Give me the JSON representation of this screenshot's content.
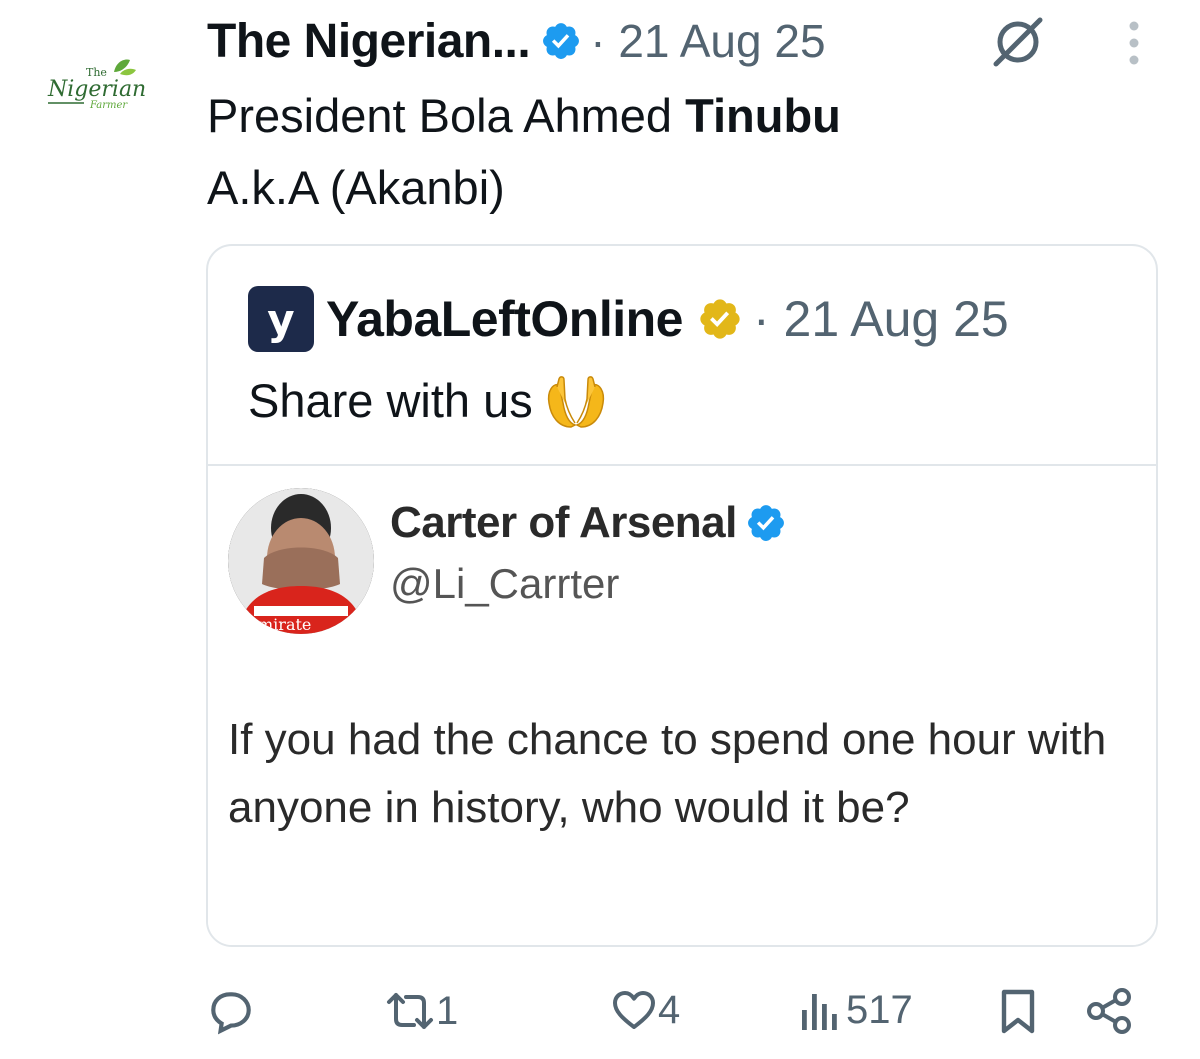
{
  "post": {
    "author_name": "The Nigerian...",
    "date": "· 21 Aug 25",
    "logo_text": {
      "top": "The",
      "middle": "Nigerian",
      "bottom": "Farmer"
    },
    "text_line1_prefix": "President Bola Ahmed ",
    "text_line1_bold": "Tinubu",
    "text_line2": "A.k.A (Akanbi)"
  },
  "quote": {
    "logo_letter": "y",
    "author_name": "YabaLeftOnline",
    "date": "· 21 Aug 25",
    "text": "Share with us",
    "embedded": {
      "name": "Carter of Arsenal",
      "handle": "@Li_Carrter",
      "text": "If you had the chance to spend one hour with anyone in history, who would it be?",
      "avatar_jersey_text": "mirate"
    }
  },
  "actions": {
    "reply_count": "",
    "repost_count": "1",
    "like_count": "4",
    "views_count": "517"
  },
  "colors": {
    "verified_blue": "#1d9bf0",
    "verified_gold": "#e2b719",
    "muted": "#536471",
    "border": "#e1e6ea",
    "brand_dark": "#1d2a4a"
  }
}
